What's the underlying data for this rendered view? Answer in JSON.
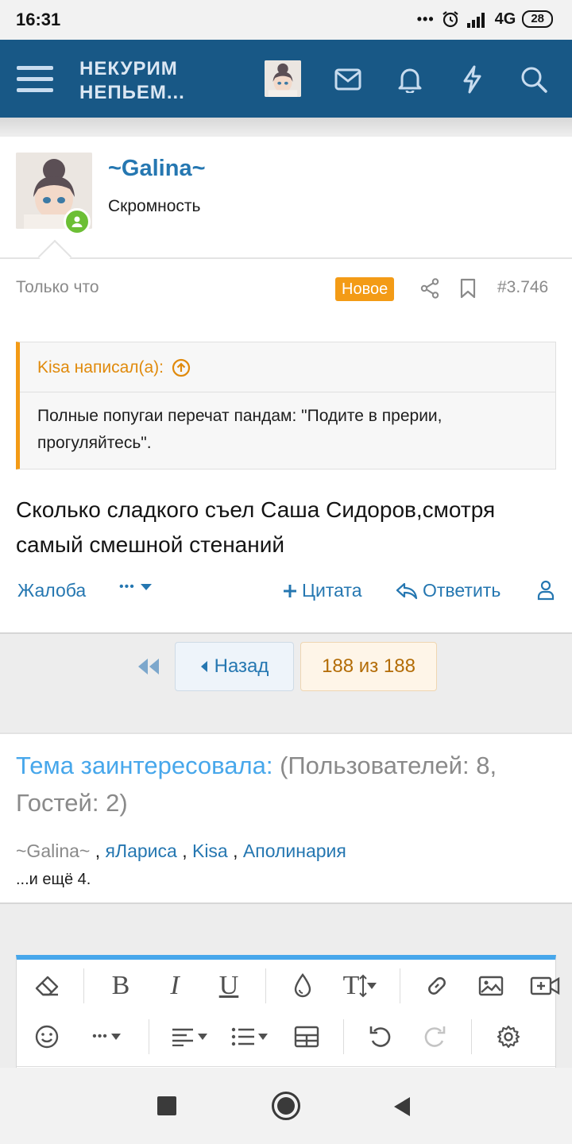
{
  "status_bar": {
    "time": "16:31",
    "network": "4G",
    "battery": "28"
  },
  "header": {
    "logo_line1": "НЕКУРИМ",
    "logo_line2": "НЕПЬЕМ..."
  },
  "post": {
    "username": "~Galina~",
    "user_title": "Скромность",
    "date": "Только что",
    "new_badge": "Новое",
    "post_number": "#3.746",
    "quote_author": "Kisa написал(а):",
    "quote_text": "Полные попугаи перечат пандам: \"Подите в прерии, прогуляйтесь\".",
    "body": "Сколько сладкого съел Саша Сидоров,смотря самый смешной стенаний",
    "actions": {
      "report": "Жалоба",
      "more": "•••",
      "quote": "Цитата",
      "reply": "Ответить"
    }
  },
  "pagination": {
    "back_label": "Назад",
    "page_label": "188 из 188"
  },
  "interested": {
    "title": "Тема заинтересовала:",
    "counts": " (Пользователей: 8, Гостей: 2)",
    "users": [
      "~Galina~",
      "яЛариса",
      "Kisa",
      "Аполинария"
    ],
    "separator": " , ",
    "more": "...и ещё 4."
  },
  "editor": {
    "bold": "B",
    "italic": "I",
    "underline": "U",
    "textsize": "T",
    "more": "•••"
  },
  "colors": {
    "header": "#185886",
    "accent_orange": "#f39b16",
    "link_blue": "#2577b1",
    "light_blue": "#47a7eb",
    "online": "#6cbf35"
  }
}
